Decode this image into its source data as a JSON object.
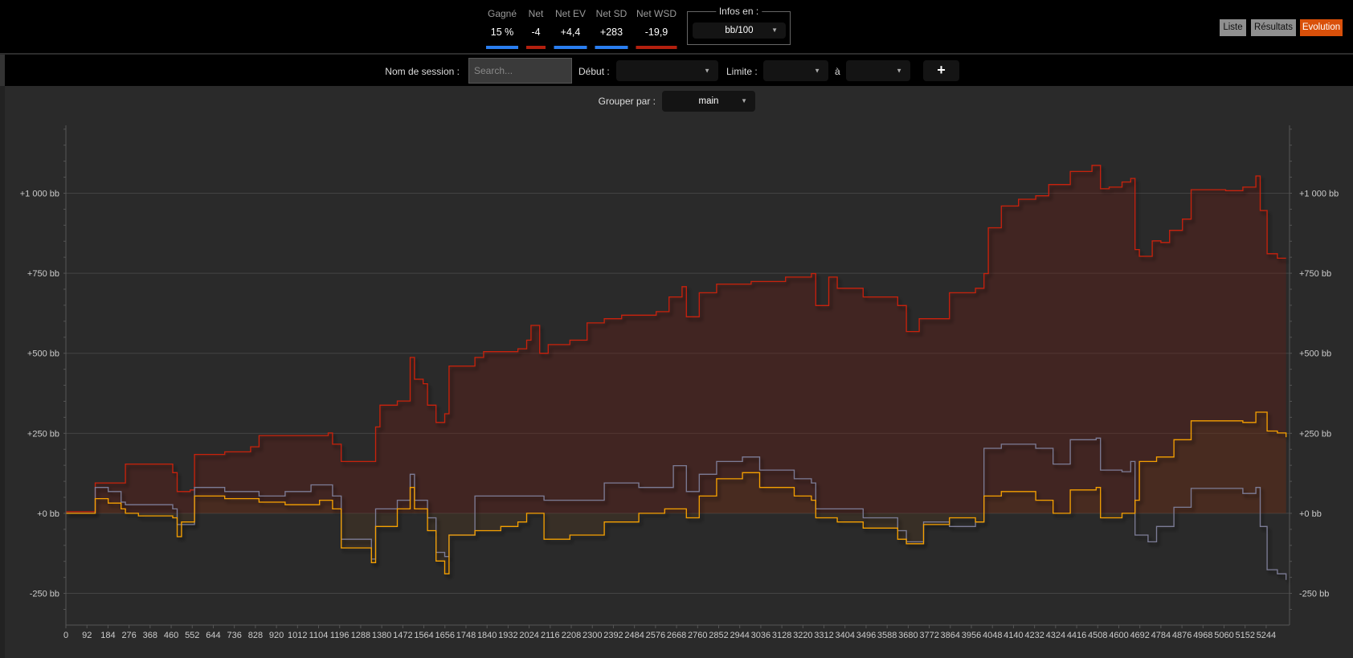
{
  "stats": [
    {
      "label": "Gagné",
      "value": "15 %",
      "color": "#2a7ef0"
    },
    {
      "label": "Net",
      "value": "-4",
      "color": "#b3200e"
    },
    {
      "label": "Net EV",
      "value": "+4,4",
      "color": "#2a7ef0"
    },
    {
      "label": "Net SD",
      "value": "+283",
      "color": "#2a7ef0"
    },
    {
      "label": "Net WSD",
      "value": "-19,9",
      "color": "#b3200e"
    }
  ],
  "infos": {
    "legend": "Infos en :",
    "value": "bb/100"
  },
  "views": {
    "list": "Liste",
    "results": "Résultats",
    "evolution": "Evolution"
  },
  "filters": {
    "session_label": "Nom de session :",
    "search_placeholder": "Search...",
    "start_label": "Début :",
    "start_value": "",
    "limit_label": "Limite :",
    "limit_from": "",
    "to_label": "à",
    "limit_to": "",
    "add": "+",
    "group_label": "Grouper par :",
    "group_value": "main"
  },
  "chart_data": {
    "type": "line",
    "xlim": [
      0,
      5346
    ],
    "ylim": [
      -349,
      1212
    ],
    "x_ticks": [
      0,
      92,
      184,
      276,
      368,
      460,
      552,
      644,
      736,
      828,
      920,
      1012,
      1104,
      1196,
      1288,
      1380,
      1472,
      1564,
      1656,
      1748,
      1840,
      1932,
      2024,
      2116,
      2208,
      2300,
      2392,
      2484,
      2576,
      2668,
      2760,
      2852,
      2944,
      3036,
      3128,
      3220,
      3312,
      3404,
      3496,
      3588,
      3680,
      3772,
      3864,
      3956,
      4048,
      4140,
      4232,
      4324,
      4416,
      4508,
      4600,
      4692,
      4784,
      4876,
      4968,
      5060,
      5152,
      5244
    ],
    "y_ticks": [
      {
        "value": -250,
        "label": "-250 bb"
      },
      {
        "value": 0,
        "label": "+0 bb"
      },
      {
        "value": 250,
        "label": "+250 bb"
      },
      {
        "value": 500,
        "label": "+500 bb"
      },
      {
        "value": 750,
        "label": "+750 bb"
      },
      {
        "value": 1000,
        "label": "+1 000 bb"
      }
    ],
    "grid": true,
    "series": [
      {
        "name": "red",
        "color": "#c8200c",
        "fill": "rgba(110,30,20,0.35)",
        "points": [
          [
            0,
            5
          ],
          [
            121,
            5
          ],
          [
            128,
            95
          ],
          [
            241,
            95
          ],
          [
            260,
            154
          ],
          [
            467,
            127
          ],
          [
            486,
            68
          ],
          [
            543,
            73
          ],
          [
            562,
            184
          ],
          [
            694,
            192
          ],
          [
            807,
            208
          ],
          [
            844,
            243
          ],
          [
            958,
            243
          ],
          [
            1146,
            251
          ],
          [
            1165,
            216
          ],
          [
            1203,
            162
          ],
          [
            1335,
            162
          ],
          [
            1353,
            270
          ],
          [
            1372,
            338
          ],
          [
            1448,
            351
          ],
          [
            1504,
            487
          ],
          [
            1523,
            419
          ],
          [
            1561,
            405
          ],
          [
            1580,
            338
          ],
          [
            1617,
            284
          ],
          [
            1655,
            311
          ],
          [
            1674,
            460
          ],
          [
            1787,
            487
          ],
          [
            1825,
            505
          ],
          [
            1975,
            514
          ],
          [
            2013,
            541
          ],
          [
            2032,
            587
          ],
          [
            2070,
            500
          ],
          [
            2107,
            527
          ],
          [
            2202,
            541
          ],
          [
            2277,
            595
          ],
          [
            2352,
            608
          ],
          [
            2428,
            619
          ],
          [
            2579,
            630
          ],
          [
            2635,
            676
          ],
          [
            2692,
            708
          ],
          [
            2711,
            614
          ],
          [
            2767,
            689
          ],
          [
            2843,
            716
          ],
          [
            2994,
            724
          ],
          [
            3144,
            738
          ],
          [
            3257,
            749
          ],
          [
            3276,
            649
          ],
          [
            3333,
            738
          ],
          [
            3370,
            703
          ],
          [
            3483,
            676
          ],
          [
            3634,
            649
          ],
          [
            3672,
            568
          ],
          [
            3728,
            608
          ],
          [
            3842,
            608
          ],
          [
            3860,
            689
          ],
          [
            3974,
            703
          ],
          [
            4011,
            749
          ],
          [
            4030,
            892
          ],
          [
            4087,
            960
          ],
          [
            4162,
            981
          ],
          [
            4237,
            992
          ],
          [
            4294,
            1027
          ],
          [
            4388,
            1068
          ],
          [
            4483,
            1087
          ],
          [
            4520,
            1014
          ],
          [
            4558,
            1019
          ],
          [
            4614,
            1035
          ],
          [
            4652,
            1046
          ],
          [
            4671,
            824
          ],
          [
            4690,
            803
          ],
          [
            4746,
            851
          ],
          [
            4784,
            846
          ],
          [
            4822,
            884
          ],
          [
            4878,
            919
          ],
          [
            4916,
            1011
          ],
          [
            5067,
            1008
          ],
          [
            5142,
            1019
          ],
          [
            5199,
            1054
          ],
          [
            5218,
            946
          ],
          [
            5248,
            811
          ],
          [
            5293,
            797
          ],
          [
            5331,
            797
          ]
        ]
      },
      {
        "name": "gray",
        "color": "#7c7c96",
        "fill": "none",
        "points": [
          [
            0,
            0
          ],
          [
            121,
            0
          ],
          [
            128,
            81
          ],
          [
            185,
            68
          ],
          [
            241,
            35
          ],
          [
            260,
            27
          ],
          [
            354,
            27
          ],
          [
            467,
            14
          ],
          [
            486,
            -35
          ],
          [
            562,
            81
          ],
          [
            694,
            68
          ],
          [
            844,
            54
          ],
          [
            958,
            68
          ],
          [
            1071,
            89
          ],
          [
            1165,
            54
          ],
          [
            1203,
            -81
          ],
          [
            1335,
            -143
          ],
          [
            1353,
            14
          ],
          [
            1448,
            41
          ],
          [
            1504,
            122
          ],
          [
            1523,
            41
          ],
          [
            1580,
            -14
          ],
          [
            1617,
            -122
          ],
          [
            1655,
            -135
          ],
          [
            1674,
            -68
          ],
          [
            1787,
            54
          ],
          [
            1900,
            54
          ],
          [
            2089,
            41
          ],
          [
            2164,
            41
          ],
          [
            2352,
            95
          ],
          [
            2503,
            81
          ],
          [
            2654,
            149
          ],
          [
            2711,
            68
          ],
          [
            2767,
            122
          ],
          [
            2843,
            162
          ],
          [
            2956,
            176
          ],
          [
            3031,
            135
          ],
          [
            3182,
            108
          ],
          [
            3257,
            95
          ],
          [
            3276,
            14
          ],
          [
            3370,
            14
          ],
          [
            3483,
            -14
          ],
          [
            3634,
            -54
          ],
          [
            3672,
            -89
          ],
          [
            3747,
            -27
          ],
          [
            3860,
            -41
          ],
          [
            3974,
            -27
          ],
          [
            4011,
            203
          ],
          [
            4087,
            216
          ],
          [
            4237,
            203
          ],
          [
            4313,
            154
          ],
          [
            4388,
            230
          ],
          [
            4501,
            235
          ],
          [
            4520,
            135
          ],
          [
            4614,
            130
          ],
          [
            4652,
            162
          ],
          [
            4671,
            -68
          ],
          [
            4728,
            -89
          ],
          [
            4765,
            -41
          ],
          [
            4841,
            19
          ],
          [
            4916,
            78
          ],
          [
            5067,
            78
          ],
          [
            5142,
            62
          ],
          [
            5199,
            81
          ],
          [
            5218,
            -41
          ],
          [
            5248,
            -176
          ],
          [
            5293,
            -189
          ],
          [
            5331,
            -208
          ]
        ]
      },
      {
        "name": "orange",
        "color": "#f5a000",
        "fill": "rgba(90,60,30,0.3)",
        "points": [
          [
            0,
            0
          ],
          [
            121,
            0
          ],
          [
            128,
            46
          ],
          [
            185,
            32
          ],
          [
            241,
            14
          ],
          [
            260,
            0
          ],
          [
            317,
            -8
          ],
          [
            467,
            -14
          ],
          [
            486,
            -73
          ],
          [
            505,
            -27
          ],
          [
            562,
            54
          ],
          [
            694,
            46
          ],
          [
            844,
            35
          ],
          [
            958,
            27
          ],
          [
            1108,
            41
          ],
          [
            1165,
            14
          ],
          [
            1203,
            -108
          ],
          [
            1335,
            -154
          ],
          [
            1353,
            -41
          ],
          [
            1448,
            14
          ],
          [
            1504,
            81
          ],
          [
            1523,
            14
          ],
          [
            1561,
            14
          ],
          [
            1580,
            -54
          ],
          [
            1617,
            -149
          ],
          [
            1655,
            -189
          ],
          [
            1674,
            -68
          ],
          [
            1787,
            -54
          ],
          [
            1900,
            -41
          ],
          [
            1975,
            -27
          ],
          [
            2013,
            0
          ],
          [
            2089,
            -81
          ],
          [
            2202,
            -68
          ],
          [
            2352,
            -27
          ],
          [
            2503,
            0
          ],
          [
            2616,
            14
          ],
          [
            2711,
            -14
          ],
          [
            2767,
            54
          ],
          [
            2843,
            108
          ],
          [
            2956,
            127
          ],
          [
            3031,
            81
          ],
          [
            3182,
            54
          ],
          [
            3257,
            41
          ],
          [
            3276,
            -14
          ],
          [
            3370,
            -27
          ],
          [
            3483,
            -46
          ],
          [
            3634,
            -81
          ],
          [
            3672,
            -95
          ],
          [
            3747,
            -35
          ],
          [
            3860,
            -14
          ],
          [
            3974,
            -27
          ],
          [
            4011,
            54
          ],
          [
            4087,
            68
          ],
          [
            4237,
            41
          ],
          [
            4313,
            0
          ],
          [
            4388,
            73
          ],
          [
            4501,
            81
          ],
          [
            4520,
            -14
          ],
          [
            4614,
            0
          ],
          [
            4671,
            41
          ],
          [
            4690,
            162
          ],
          [
            4765,
            176
          ],
          [
            4841,
            230
          ],
          [
            4916,
            289
          ],
          [
            5067,
            289
          ],
          [
            5142,
            284
          ],
          [
            5199,
            316
          ],
          [
            5248,
            257
          ],
          [
            5293,
            251
          ],
          [
            5331,
            238
          ]
        ]
      }
    ]
  }
}
